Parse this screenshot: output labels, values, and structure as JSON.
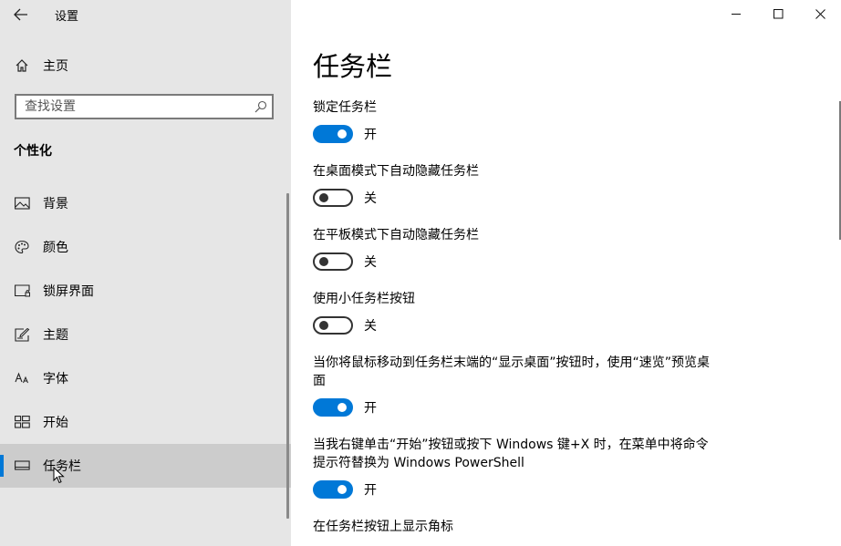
{
  "app": {
    "title": "设置"
  },
  "sidebar": {
    "home_label": "主页",
    "search_placeholder": "查找设置",
    "section_title": "个性化",
    "items": [
      {
        "label": "背景",
        "icon": "picture-icon"
      },
      {
        "label": "颜色",
        "icon": "palette-icon"
      },
      {
        "label": "锁屏界面",
        "icon": "lock-screen-icon"
      },
      {
        "label": "主题",
        "icon": "theme-brush-icon"
      },
      {
        "label": "字体",
        "icon": "font-icon"
      },
      {
        "label": "开始",
        "icon": "start-tiles-icon"
      },
      {
        "label": "任务栏",
        "icon": "taskbar-icon",
        "active": true
      }
    ]
  },
  "main": {
    "title": "任务栏",
    "settings": [
      {
        "label": "锁定任务栏",
        "state": "开",
        "on": true
      },
      {
        "label": "在桌面模式下自动隐藏任务栏",
        "state": "关",
        "on": false
      },
      {
        "label": "在平板模式下自动隐藏任务栏",
        "state": "关",
        "on": false
      },
      {
        "label": "使用小任务栏按钮",
        "state": "关",
        "on": false
      },
      {
        "label": "当你将鼠标移动到任务栏末端的“显示桌面”按钮时，使用“速览”预览桌面",
        "state": "开",
        "on": true
      },
      {
        "label": "当我右键单击“开始”按钮或按下 Windows 键+X 时，在菜单中将命令提示符替换为 Windows PowerShell",
        "state": "开",
        "on": true
      },
      {
        "label": "在任务栏按钮上显示角标"
      }
    ]
  },
  "colors": {
    "accent": "#0078d7",
    "sidebar_bg": "#e6e6e6",
    "selected_bg": "#cccccc"
  }
}
